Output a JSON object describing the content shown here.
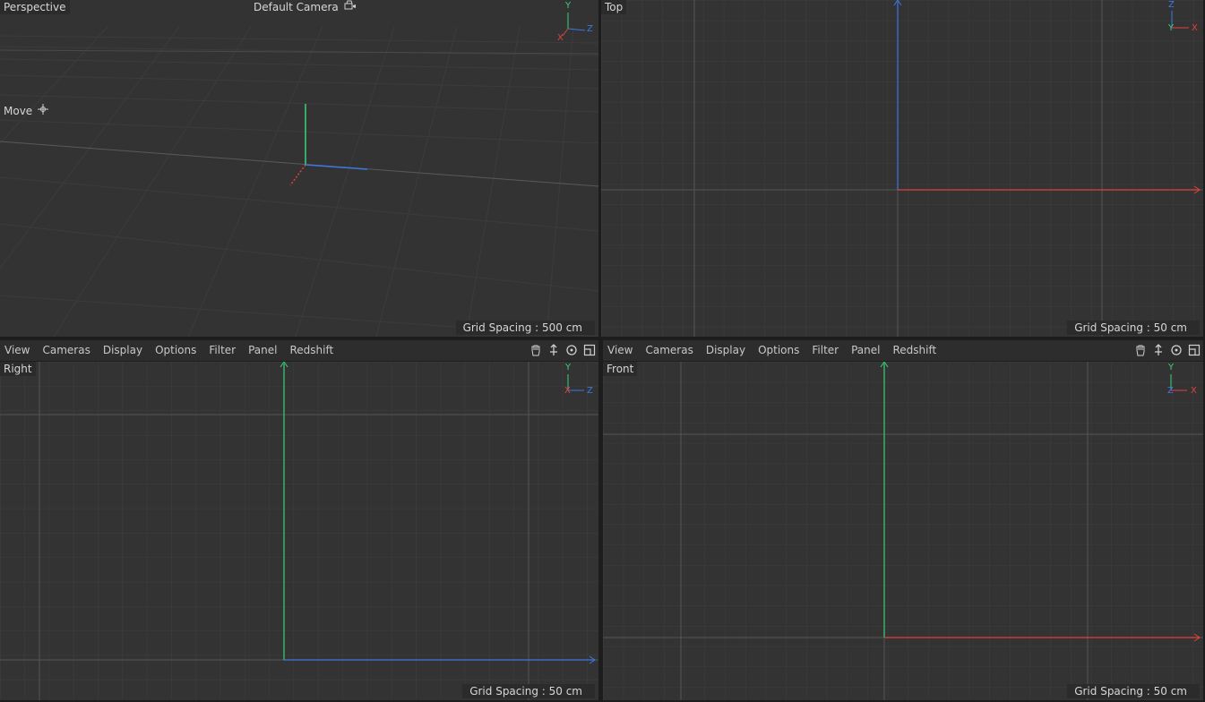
{
  "viewports": {
    "perspective": {
      "name": "Perspective",
      "camera": "Default Camera",
      "tool": "Move",
      "grid_spacing": "Grid Spacing : 500 cm",
      "axes": {
        "y": "Y",
        "z": "Z",
        "x": "X"
      }
    },
    "top": {
      "name": "Top",
      "grid_spacing": "Grid Spacing : 50 cm",
      "axes": {
        "z": "Z",
        "y": "Y",
        "x": "X"
      }
    },
    "right": {
      "name": "Right",
      "grid_spacing": "Grid Spacing : 50 cm",
      "axes": {
        "y": "Y",
        "x": "X",
        "z": "Z"
      }
    },
    "front": {
      "name": "Front",
      "grid_spacing": "Grid Spacing : 50 cm",
      "axes": {
        "y": "Y",
        "z": "Z",
        "x": "X"
      }
    }
  },
  "menu": {
    "view": "View",
    "cameras": "Cameras",
    "display": "Display",
    "options": "Options",
    "filter": "Filter",
    "panel": "Panel",
    "redshift": "Redshift"
  },
  "icons": {
    "pan": "hand-icon",
    "dolly": "move-vertical-icon",
    "orbit": "rotate-icon",
    "maximize": "maximize-viewport-icon",
    "camera_lock": "camera-icon",
    "move_tool": "move-tool-icon"
  },
  "colors": {
    "x_axis": "#e0423e",
    "y_axis": "#3ad17a",
    "z_axis": "#3c78e0",
    "viewport_bg": "#333333",
    "grid_line": "#3f3f3f",
    "grid_major": "#555555"
  }
}
